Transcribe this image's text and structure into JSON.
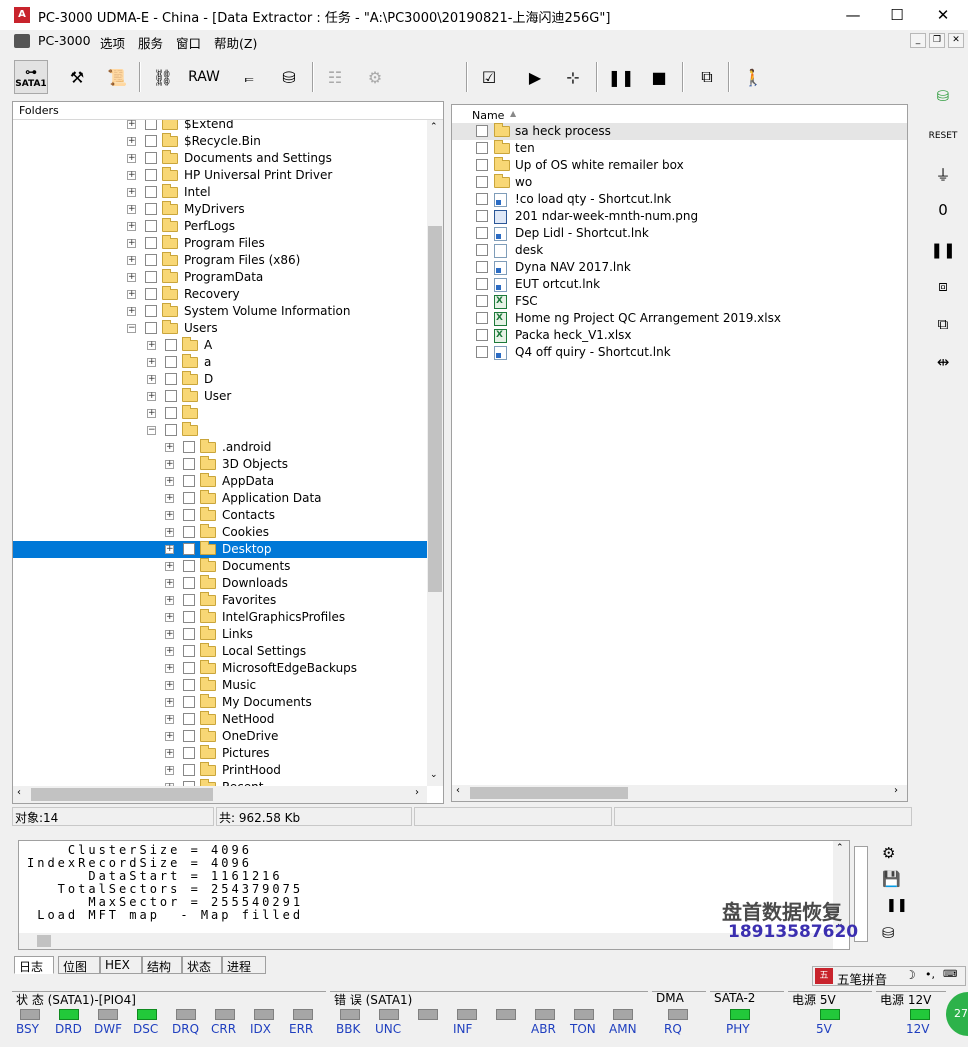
{
  "window": {
    "title": "PC-3000 UDMA-E - China - [Data Extractor : 任务 - \"A:\\PC3000\\20190821-上海闪迪256G\"]",
    "minimize": "—",
    "maximize": "☐",
    "close": "✕"
  },
  "menu": [
    "PC-3000",
    "选项",
    "服务",
    "窗口",
    "帮助(Z)"
  ],
  "toolbar": {
    "sata_label": "SATA1",
    "raw_label": "RAW"
  },
  "left_panel": {
    "header": "Folders",
    "items": [
      {
        "label": "$Extend",
        "level": 0
      },
      {
        "label": "$Recycle.Bin",
        "level": 0
      },
      {
        "label": "Documents and Settings",
        "level": 0
      },
      {
        "label": "HP Universal Print Driver",
        "level": 0
      },
      {
        "label": "Intel",
        "level": 0
      },
      {
        "label": "MyDrivers",
        "level": 0
      },
      {
        "label": "PerfLogs",
        "level": 0
      },
      {
        "label": "Program Files",
        "level": 0
      },
      {
        "label": "Program Files (x86)",
        "level": 0
      },
      {
        "label": "ProgramData",
        "level": 0
      },
      {
        "label": "Recovery",
        "level": 0
      },
      {
        "label": "System Volume Information",
        "level": 0
      },
      {
        "label": "Users",
        "level": 0,
        "expanded": true
      },
      {
        "label": "A",
        "level": 1
      },
      {
        "label": "a",
        "level": 1
      },
      {
        "label": "D",
        "level": 1
      },
      {
        "label": "User",
        "level": 1
      },
      {
        "label": "",
        "level": 1
      },
      {
        "label": "",
        "level": 1,
        "expanded": true
      },
      {
        "label": ".android",
        "level": 2
      },
      {
        "label": "3D Objects",
        "level": 2
      },
      {
        "label": "AppData",
        "level": 2
      },
      {
        "label": "Application Data",
        "level": 2
      },
      {
        "label": "Contacts",
        "level": 2
      },
      {
        "label": "Cookies",
        "level": 2
      },
      {
        "label": "Desktop",
        "level": 2,
        "selected": true
      },
      {
        "label": "Documents",
        "level": 2
      },
      {
        "label": "Downloads",
        "level": 2
      },
      {
        "label": "Favorites",
        "level": 2
      },
      {
        "label": "IntelGraphicsProfiles",
        "level": 2
      },
      {
        "label": "Links",
        "level": 2
      },
      {
        "label": "Local Settings",
        "level": 2
      },
      {
        "label": "MicrosoftEdgeBackups",
        "level": 2
      },
      {
        "label": "Music",
        "level": 2
      },
      {
        "label": "My Documents",
        "level": 2
      },
      {
        "label": "NetHood",
        "level": 2
      },
      {
        "label": "OneDrive",
        "level": 2
      },
      {
        "label": "Pictures",
        "level": 2
      },
      {
        "label": "PrintHood",
        "level": 2
      },
      {
        "label": "Recent",
        "level": 2
      }
    ]
  },
  "right_panel": {
    "column_header": "Name",
    "files": [
      {
        "name": "sa  heck process",
        "type": "folder"
      },
      {
        "name": "ten",
        "type": "folder"
      },
      {
        "name": "Up  of OS white remailer box",
        "type": "folder"
      },
      {
        "name": "wo",
        "type": "folder"
      },
      {
        "name": "!co  load qty - Shortcut.lnk",
        "type": "lnk"
      },
      {
        "name": "201  ndar-week-mnth-num.png",
        "type": "png"
      },
      {
        "name": "Dep  Lidl - Shortcut.lnk",
        "type": "lnk"
      },
      {
        "name": "desk",
        "type": "ini"
      },
      {
        "name": "Dyna  NAV 2017.lnk",
        "type": "lnk"
      },
      {
        "name": "EUT  ortcut.lnk",
        "type": "lnk"
      },
      {
        "name": "FSC",
        "type": "xls"
      },
      {
        "name": "Home  ng Project QC Arrangement  2019.xlsx",
        "type": "xls"
      },
      {
        "name": "Packa  heck_V1.xlsx",
        "type": "xls"
      },
      {
        "name": "Q4 off  quiry - Shortcut.lnk",
        "type": "lnk"
      }
    ]
  },
  "status": {
    "objects": "对象:14",
    "total": "共: 962.58 Kb"
  },
  "log": {
    "text": "    ClusterSize = 4096\nIndexRecordSize = 4096\n      DataStart = 1161216\n   TotalSectors = 254379075\n      MaxSector = 255540291\n Load MFT map  - Map filled"
  },
  "log_tabs": [
    "日志",
    "位图",
    "HEX",
    "结构",
    "状态",
    "进程"
  ],
  "ime": {
    "label": "五笔拼音"
  },
  "watermark": {
    "line1": "盘首数据恢复",
    "line2": "18913587620"
  },
  "indicators": {
    "status_group": {
      "title": "状 态 (SATA1)-[PIO4]",
      "leds": [
        {
          "label": "BSY",
          "on": false
        },
        {
          "label": "DRD",
          "on": true
        },
        {
          "label": "DWF",
          "on": false
        },
        {
          "label": "DSC",
          "on": true
        },
        {
          "label": "DRQ",
          "on": false
        },
        {
          "label": "CRR",
          "on": false
        },
        {
          "label": "IDX",
          "on": false
        },
        {
          "label": "ERR",
          "on": false
        }
      ]
    },
    "error_group": {
      "title": "错 误 (SATA1)",
      "leds": [
        {
          "label": "BBK",
          "on": false
        },
        {
          "label": "UNC",
          "on": false
        },
        {
          "label": "",
          "on": false
        },
        {
          "label": "INF",
          "on": false
        },
        {
          "label": "",
          "on": false
        },
        {
          "label": "ABR",
          "on": false
        },
        {
          "label": "TON",
          "on": false
        },
        {
          "label": "AMN",
          "on": false
        }
      ]
    },
    "dma_group": {
      "title": "DMA",
      "leds": [
        {
          "label": "RQ",
          "on": false
        }
      ]
    },
    "sata2_group": {
      "title": "SATA-2",
      "leds": [
        {
          "label": "PHY",
          "on": true
        }
      ]
    },
    "power5_group": {
      "title": "电源 5V",
      "leds": [
        {
          "label": "5V",
          "on": true
        }
      ]
    },
    "power12_group": {
      "title": "电源 12V",
      "leds": [
        {
          "label": "12V",
          "on": true
        }
      ]
    }
  },
  "corner_badge": "27"
}
